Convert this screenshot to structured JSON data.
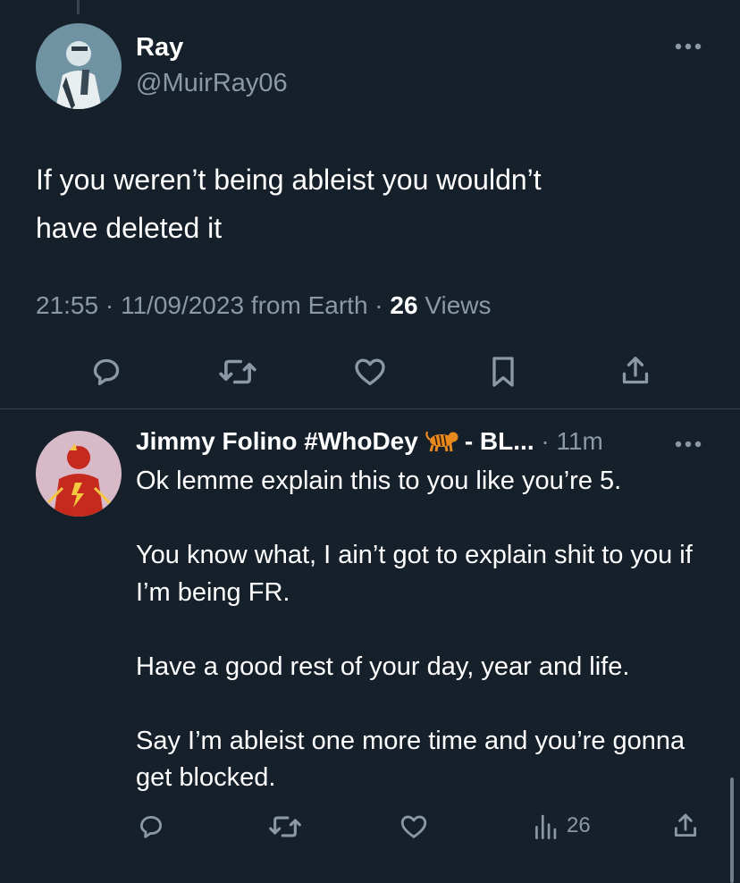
{
  "main_tweet": {
    "author_name": "Ray",
    "author_handle": "@MuirRay06",
    "text": "If you weren’t being ableist you wouldn’t\nhave deleted it",
    "time": "21:55",
    "date": "11/09/2023",
    "source": "from Earth",
    "views_count": "26",
    "views_label": "Views",
    "actions": [
      "reply-icon",
      "retweet-icon",
      "like-icon",
      "bookmark-icon",
      "share-icon"
    ]
  },
  "reply_tweet": {
    "author_name": "Jimmy Folino #WhoDey",
    "author_suffix": "- BL...",
    "time": "· 11m",
    "text": "Ok lemme explain this to you like you’re 5.\n\nYou know what, I ain’t got to explain shit to you if I’m being FR.\n\nHave a good rest of your day, year and life.\n\nSay I’m ableist one more time and you’re gonna get blocked.",
    "views_count": "26",
    "actions": [
      "reply-icon",
      "retweet-icon",
      "like-icon",
      "views-icon",
      "share-icon"
    ]
  },
  "colors": {
    "background": "#15202b",
    "secondary_text": "#8b98a5",
    "divider": "#38444d"
  }
}
